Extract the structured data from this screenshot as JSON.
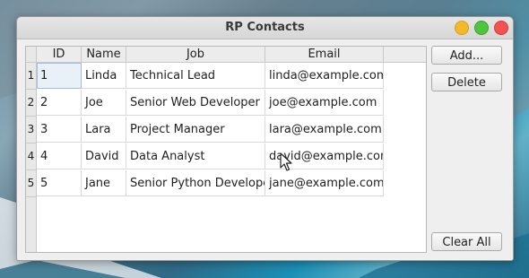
{
  "window": {
    "title": "RP Contacts"
  },
  "table": {
    "columns": [
      "ID",
      "Name",
      "Job",
      "Email"
    ],
    "rows": [
      {
        "rownum": "1",
        "cells": [
          "1",
          "Linda",
          "Technical Lead",
          "linda@example.com"
        ]
      },
      {
        "rownum": "2",
        "cells": [
          "2",
          "Joe",
          "Senior Web Developer",
          "joe@example.com"
        ]
      },
      {
        "rownum": "3",
        "cells": [
          "3",
          "Lara",
          "Project Manager",
          "lara@example.com"
        ]
      },
      {
        "rownum": "4",
        "cells": [
          "4",
          "David",
          "Data Analyst",
          "david@example.com"
        ]
      },
      {
        "rownum": "5",
        "cells": [
          "5",
          "Jane",
          "Senior Python Developer",
          "jane@example.com"
        ]
      }
    ]
  },
  "buttons": {
    "add_label": "Add...",
    "delete_label": "Delete",
    "clear_label": "Clear All"
  },
  "colors": {
    "close": "#f25252",
    "minimize": "#f3b92b",
    "maximize": "#4fc53d",
    "selection": "#e8f1f8"
  }
}
